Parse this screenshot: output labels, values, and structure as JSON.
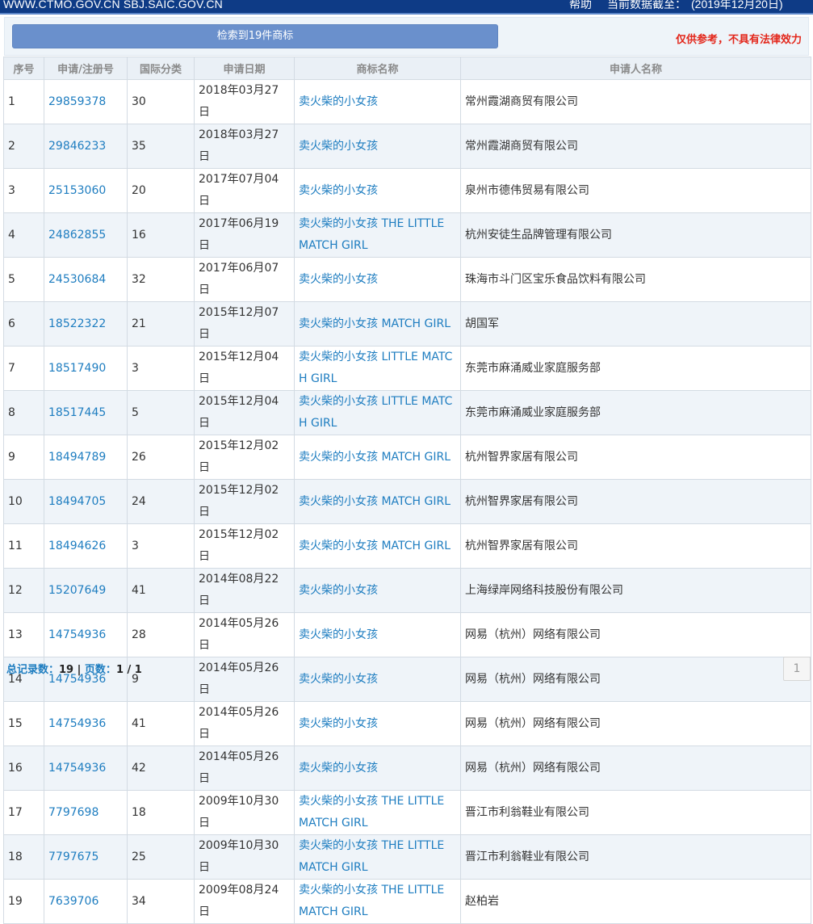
{
  "header": {
    "sites": "WWW.CTMO.GOV.CN SBJ.SAIC.GOV.CN",
    "help": "帮助",
    "asof_label": "当前数据截至：",
    "asof_date": "(2019年12月20日)"
  },
  "toolbar": {
    "result_label": "检索到19件商标",
    "disclaimer": "仅供参考，不具有法律效力"
  },
  "table": {
    "columns": [
      "序号",
      "申请/注册号",
      "国际分类",
      "申请日期",
      "商标名称",
      "申请人名称"
    ],
    "rows": [
      {
        "no": "1",
        "reg": "29859378",
        "cls": "30",
        "date": "2018年03月27日",
        "mark": "卖火柴的小女孩",
        "applicant": "常州霞湖商贸有限公司"
      },
      {
        "no": "2",
        "reg": "29846233",
        "cls": "35",
        "date": "2018年03月27日",
        "mark": "卖火柴的小女孩",
        "applicant": "常州霞湖商贸有限公司"
      },
      {
        "no": "3",
        "reg": "25153060",
        "cls": "20",
        "date": "2017年07月04日",
        "mark": "卖火柴的小女孩",
        "applicant": "泉州市德伟贸易有限公司"
      },
      {
        "no": "4",
        "reg": "24862855",
        "cls": "16",
        "date": "2017年06月19日",
        "mark": "卖火柴的小女孩 THE LITTLE MATCH GIRL",
        "applicant": "杭州安徒生品牌管理有限公司"
      },
      {
        "no": "5",
        "reg": "24530684",
        "cls": "32",
        "date": "2017年06月07日",
        "mark": "卖火柴的小女孩",
        "applicant": "珠海市斗门区宝乐食品饮料有限公司"
      },
      {
        "no": "6",
        "reg": "18522322",
        "cls": "21",
        "date": "2015年12月07日",
        "mark": "卖火柴的小女孩 MATCH GIRL",
        "applicant": "胡国军"
      },
      {
        "no": "7",
        "reg": "18517490",
        "cls": "3",
        "date": "2015年12月04日",
        "mark": "卖火柴的小女孩 LITTLE MATCH GIRL",
        "applicant": "东莞市麻涌威业家庭服务部"
      },
      {
        "no": "8",
        "reg": "18517445",
        "cls": "5",
        "date": "2015年12月04日",
        "mark": "卖火柴的小女孩 LITTLE MATCH GIRL",
        "applicant": "东莞市麻涌威业家庭服务部"
      },
      {
        "no": "9",
        "reg": "18494789",
        "cls": "26",
        "date": "2015年12月02日",
        "mark": "卖火柴的小女孩 MATCH GIRL",
        "applicant": "杭州智界家居有限公司"
      },
      {
        "no": "10",
        "reg": "18494705",
        "cls": "24",
        "date": "2015年12月02日",
        "mark": "卖火柴的小女孩 MATCH GIRL",
        "applicant": "杭州智界家居有限公司"
      },
      {
        "no": "11",
        "reg": "18494626",
        "cls": "3",
        "date": "2015年12月02日",
        "mark": "卖火柴的小女孩 MATCH GIRL",
        "applicant": "杭州智界家居有限公司"
      },
      {
        "no": "12",
        "reg": "15207649",
        "cls": "41",
        "date": "2014年08月22日",
        "mark": "卖火柴的小女孩",
        "applicant": "上海绿岸网络科技股份有限公司"
      },
      {
        "no": "13",
        "reg": "14754936",
        "cls": "28",
        "date": "2014年05月26日",
        "mark": "卖火柴的小女孩",
        "applicant": "网易（杭州）网络有限公司"
      },
      {
        "no": "14",
        "reg": "14754936",
        "cls": "9",
        "date": "2014年05月26日",
        "mark": "卖火柴的小女孩",
        "applicant": "网易（杭州）网络有限公司"
      },
      {
        "no": "15",
        "reg": "14754936",
        "cls": "41",
        "date": "2014年05月26日",
        "mark": "卖火柴的小女孩",
        "applicant": "网易（杭州）网络有限公司"
      },
      {
        "no": "16",
        "reg": "14754936",
        "cls": "42",
        "date": "2014年05月26日",
        "mark": "卖火柴的小女孩",
        "applicant": "网易（杭州）网络有限公司"
      },
      {
        "no": "17",
        "reg": "7797698",
        "cls": "18",
        "date": "2009年10月30日",
        "mark": "卖火柴的小女孩 THE LITTLE MATCH GIRL",
        "applicant": "晋江市利翁鞋业有限公司"
      },
      {
        "no": "18",
        "reg": "7797675",
        "cls": "25",
        "date": "2009年10月30日",
        "mark": "卖火柴的小女孩 THE LITTLE MATCH GIRL",
        "applicant": "晋江市利翁鞋业有限公司"
      },
      {
        "no": "19",
        "reg": "7639706",
        "cls": "34",
        "date": "2009年08月24日",
        "mark": "卖火柴的小女孩 THE LITTLE MATCH GIRL",
        "applicant": "赵柏岩"
      }
    ]
  },
  "footer": {
    "total_label": "总记录数：",
    "total_value": "19",
    "sep": " | ",
    "pages_label": "页数：",
    "pages_value": "1 / 1",
    "page_button": "1"
  }
}
